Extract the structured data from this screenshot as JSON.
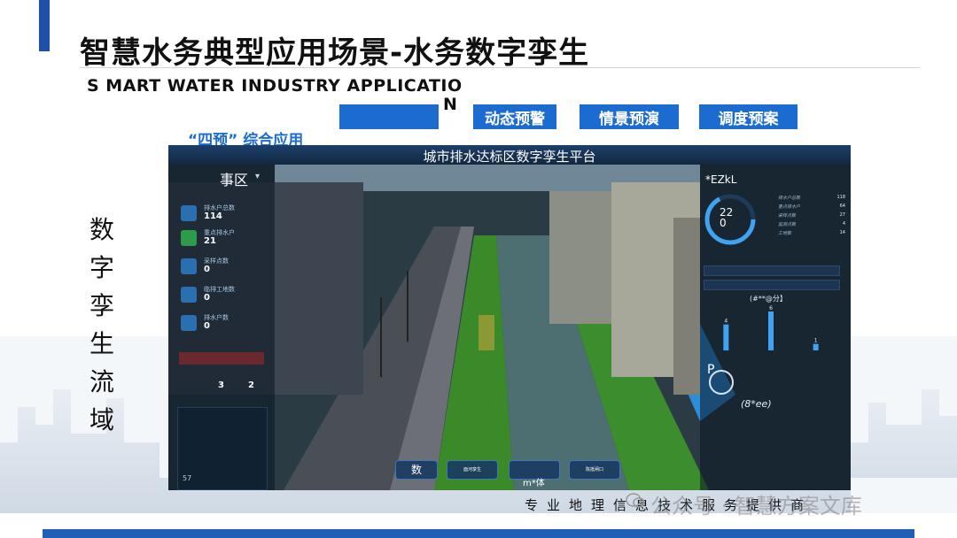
{
  "slide": {
    "title": "智慧水务典型应用场景-水务数字孪生",
    "subtitle_main": "S MART WATER INDUSTRY APPLICATIO",
    "subtitle_tail": "N",
    "four_label": "“四预” 综合应用",
    "vertical_text": [
      "数",
      "字",
      "孪",
      "生",
      "流",
      "域"
    ],
    "footer_text": "专业地理信息技术服务提供商",
    "watermark": "公众号 · 智慧方案文库"
  },
  "tabs": [
    {
      "label": ""
    },
    {
      "label": "动态预警"
    },
    {
      "label": "情景预演"
    },
    {
      "label": "调度预案"
    }
  ],
  "platform": {
    "title": "城市排水达标区数字孪生平台",
    "region": "事区",
    "stats": [
      {
        "label": "排水户总数",
        "value": "114",
        "icon": "building-icon"
      },
      {
        "label": "重点排水户",
        "value": "21",
        "icon": "factory-icon"
      },
      {
        "label": "采样点数",
        "value": "0",
        "icon": "flask-icon"
      },
      {
        "label": "临排工地数",
        "value": "0",
        "icon": "house-icon"
      },
      {
        "label": "排水户数",
        "value": "0",
        "icon": "grid-icon"
      }
    ],
    "warn_values": [
      "3",
      "2"
    ],
    "bottom_left_value": "57",
    "right": {
      "header": "*EZkL",
      "gauge_top": "22",
      "gauge_bottom": "0",
      "kv": [
        {
          "k": "排水户总数",
          "v": "118"
        },
        {
          "k": "重点排水户",
          "v": "64"
        },
        {
          "k": "采样点数",
          "v": "27"
        },
        {
          "k": "监测点数",
          "v": "4"
        },
        {
          "k": "工地数",
          "v": "14"
        }
      ],
      "sign": "(#**@分】",
      "bars": [
        4,
        6,
        1
      ],
      "p_label": "P",
      "p_value": "(8*ee)"
    },
    "bottom_buttons": [
      {
        "label": "数"
      },
      {
        "label": "面河孪生"
      },
      {
        "label": ""
      },
      {
        "label": "陈抵闸口"
      }
    ],
    "bottom_mark": "m*体"
  },
  "colors": {
    "accent": "#1f4fa8",
    "tab_blue": "#1c6bd1",
    "platform_bg": "#12202c"
  }
}
